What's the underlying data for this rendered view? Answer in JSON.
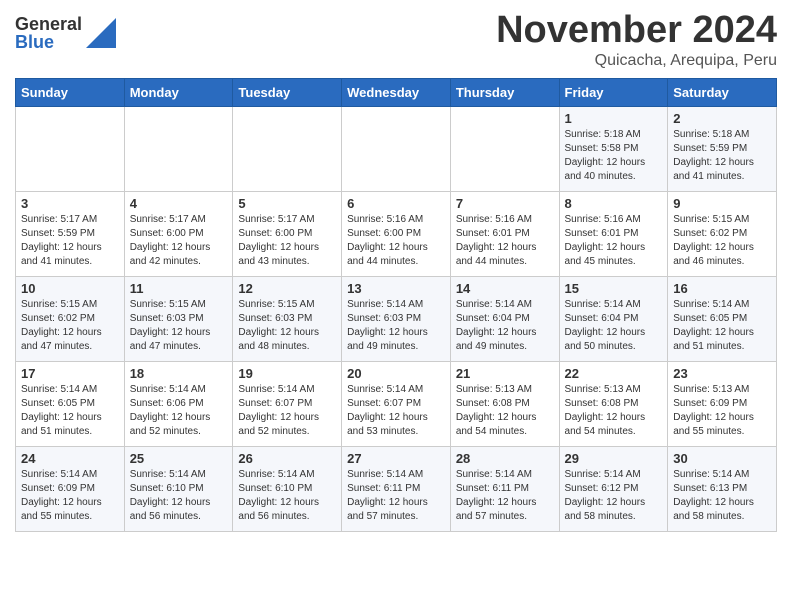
{
  "logo": {
    "general": "General",
    "blue": "Blue"
  },
  "title": {
    "month": "November 2024",
    "location": "Quicacha, Arequipa, Peru"
  },
  "weekdays": [
    "Sunday",
    "Monday",
    "Tuesday",
    "Wednesday",
    "Thursday",
    "Friday",
    "Saturday"
  ],
  "weeks": [
    [
      {
        "day": "",
        "info": ""
      },
      {
        "day": "",
        "info": ""
      },
      {
        "day": "",
        "info": ""
      },
      {
        "day": "",
        "info": ""
      },
      {
        "day": "",
        "info": ""
      },
      {
        "day": "1",
        "info": "Sunrise: 5:18 AM\nSunset: 5:58 PM\nDaylight: 12 hours\nand 40 minutes."
      },
      {
        "day": "2",
        "info": "Sunrise: 5:18 AM\nSunset: 5:59 PM\nDaylight: 12 hours\nand 41 minutes."
      }
    ],
    [
      {
        "day": "3",
        "info": "Sunrise: 5:17 AM\nSunset: 5:59 PM\nDaylight: 12 hours\nand 41 minutes."
      },
      {
        "day": "4",
        "info": "Sunrise: 5:17 AM\nSunset: 6:00 PM\nDaylight: 12 hours\nand 42 minutes."
      },
      {
        "day": "5",
        "info": "Sunrise: 5:17 AM\nSunset: 6:00 PM\nDaylight: 12 hours\nand 43 minutes."
      },
      {
        "day": "6",
        "info": "Sunrise: 5:16 AM\nSunset: 6:00 PM\nDaylight: 12 hours\nand 44 minutes."
      },
      {
        "day": "7",
        "info": "Sunrise: 5:16 AM\nSunset: 6:01 PM\nDaylight: 12 hours\nand 44 minutes."
      },
      {
        "day": "8",
        "info": "Sunrise: 5:16 AM\nSunset: 6:01 PM\nDaylight: 12 hours\nand 45 minutes."
      },
      {
        "day": "9",
        "info": "Sunrise: 5:15 AM\nSunset: 6:02 PM\nDaylight: 12 hours\nand 46 minutes."
      }
    ],
    [
      {
        "day": "10",
        "info": "Sunrise: 5:15 AM\nSunset: 6:02 PM\nDaylight: 12 hours\nand 47 minutes."
      },
      {
        "day": "11",
        "info": "Sunrise: 5:15 AM\nSunset: 6:03 PM\nDaylight: 12 hours\nand 47 minutes."
      },
      {
        "day": "12",
        "info": "Sunrise: 5:15 AM\nSunset: 6:03 PM\nDaylight: 12 hours\nand 48 minutes."
      },
      {
        "day": "13",
        "info": "Sunrise: 5:14 AM\nSunset: 6:03 PM\nDaylight: 12 hours\nand 49 minutes."
      },
      {
        "day": "14",
        "info": "Sunrise: 5:14 AM\nSunset: 6:04 PM\nDaylight: 12 hours\nand 49 minutes."
      },
      {
        "day": "15",
        "info": "Sunrise: 5:14 AM\nSunset: 6:04 PM\nDaylight: 12 hours\nand 50 minutes."
      },
      {
        "day": "16",
        "info": "Sunrise: 5:14 AM\nSunset: 6:05 PM\nDaylight: 12 hours\nand 51 minutes."
      }
    ],
    [
      {
        "day": "17",
        "info": "Sunrise: 5:14 AM\nSunset: 6:05 PM\nDaylight: 12 hours\nand 51 minutes."
      },
      {
        "day": "18",
        "info": "Sunrise: 5:14 AM\nSunset: 6:06 PM\nDaylight: 12 hours\nand 52 minutes."
      },
      {
        "day": "19",
        "info": "Sunrise: 5:14 AM\nSunset: 6:07 PM\nDaylight: 12 hours\nand 52 minutes."
      },
      {
        "day": "20",
        "info": "Sunrise: 5:14 AM\nSunset: 6:07 PM\nDaylight: 12 hours\nand 53 minutes."
      },
      {
        "day": "21",
        "info": "Sunrise: 5:13 AM\nSunset: 6:08 PM\nDaylight: 12 hours\nand 54 minutes."
      },
      {
        "day": "22",
        "info": "Sunrise: 5:13 AM\nSunset: 6:08 PM\nDaylight: 12 hours\nand 54 minutes."
      },
      {
        "day": "23",
        "info": "Sunrise: 5:13 AM\nSunset: 6:09 PM\nDaylight: 12 hours\nand 55 minutes."
      }
    ],
    [
      {
        "day": "24",
        "info": "Sunrise: 5:14 AM\nSunset: 6:09 PM\nDaylight: 12 hours\nand 55 minutes."
      },
      {
        "day": "25",
        "info": "Sunrise: 5:14 AM\nSunset: 6:10 PM\nDaylight: 12 hours\nand 56 minutes."
      },
      {
        "day": "26",
        "info": "Sunrise: 5:14 AM\nSunset: 6:10 PM\nDaylight: 12 hours\nand 56 minutes."
      },
      {
        "day": "27",
        "info": "Sunrise: 5:14 AM\nSunset: 6:11 PM\nDaylight: 12 hours\nand 57 minutes."
      },
      {
        "day": "28",
        "info": "Sunrise: 5:14 AM\nSunset: 6:11 PM\nDaylight: 12 hours\nand 57 minutes."
      },
      {
        "day": "29",
        "info": "Sunrise: 5:14 AM\nSunset: 6:12 PM\nDaylight: 12 hours\nand 58 minutes."
      },
      {
        "day": "30",
        "info": "Sunrise: 5:14 AM\nSunset: 6:13 PM\nDaylight: 12 hours\nand 58 minutes."
      }
    ]
  ]
}
